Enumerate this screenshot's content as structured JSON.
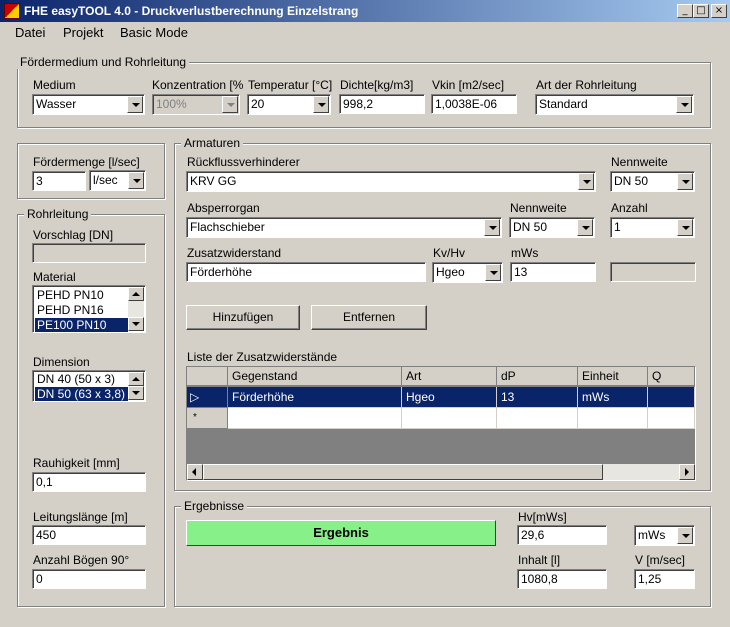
{
  "window": {
    "title": "FHE easyTOOL 4.0 - Druckverlustberechnung Einzelstrang",
    "buttons": {
      "minimize": "_",
      "maximize": "□",
      "close": "×"
    }
  },
  "menu": [
    "Datei",
    "Projekt",
    "Basic Mode"
  ],
  "medium_group": {
    "title": "Fördermedium und Rohrleitung",
    "medium_label": "Medium",
    "medium_value": "Wasser",
    "konz_label": "Konzentration [%",
    "konz_value": "100%",
    "temp_label": "Temperatur [°C]",
    "temp_value": "20",
    "dichte_label": "Dichte[kg/m3]",
    "dichte_value": "998,2",
    "vkin_label": "Vkin [m2/sec]",
    "vkin_value": "1,0038E-06",
    "art_label": "Art der Rohrleitung",
    "art_value": "Standard"
  },
  "foerdermenge": {
    "label": "Fördermenge [l/sec]",
    "value": "3",
    "unit": "l/sec"
  },
  "rohrleitung": {
    "title": "Rohrleitung",
    "vorschlag_label": "Vorschlag [DN]",
    "vorschlag_value": "",
    "material_label": "Material",
    "material_items": [
      "PEHD PN10",
      "PEHD PN16",
      "PE100 PN10"
    ],
    "material_selected": 2,
    "dimension_label": "Dimension",
    "dimension_items": [
      "DN 40 (50 x 3)",
      "DN 50 (63 x 3,8)"
    ],
    "dimension_selected": 1,
    "rauhigkeit_label": "Rauhigkeit [mm]",
    "rauhigkeit_value": "0,1",
    "laenge_label": "Leitungslänge [m]",
    "laenge_value": "450",
    "boegen_label": "Anzahl Bögen 90°",
    "boegen_value": "0"
  },
  "armaturen": {
    "title": "Armaturen",
    "rv_label": "Rückflussverhinderer",
    "rv_value": "KRV GG",
    "nw1_label": "Nennweite",
    "nw1_value": "DN 50",
    "abs_label": "Absperrorgan",
    "abs_value": "Flachschieber",
    "nw2_label": "Nennweite",
    "nw2_value": "DN 50",
    "anzahl_label": "Anzahl",
    "anzahl_value": "1",
    "zus_label": "Zusatzwiderstand",
    "zus_value": "Förderhöhe",
    "kvhv_label": "Kv/Hv",
    "kvhv_value": "Hgeo",
    "mws_label": "mWs",
    "mws_value": "13",
    "extra_value": "",
    "add_button": "Hinzufügen",
    "remove_button": "Entfernen",
    "list_label": "Liste der Zusatzwiderstände",
    "columns": [
      "Gegenstand",
      "Art",
      "dP",
      "Einheit",
      "Q"
    ],
    "rows": [
      {
        "marker": "▷",
        "cells": [
          "Förderhöhe",
          "Hgeo",
          "13",
          "mWs",
          ""
        ]
      },
      {
        "marker": "*",
        "cells": [
          "",
          "",
          "",
          "",
          ""
        ]
      }
    ]
  },
  "ergebnisse": {
    "title": "Ergebnisse",
    "button": "Ergebnis",
    "hv_label": "Hv[mWs]",
    "hv_value": "29,6",
    "hv_unit": "mWs",
    "inhalt_label": "Inhalt [l]",
    "inhalt_value": "1080,8",
    "v_label": "V [m/sec]",
    "v_value": "1,25"
  },
  "colors": {
    "titlebar_start": "#0a246a",
    "titlebar_end": "#a6caf0",
    "selection": "#0a246a",
    "result_button": "#88f088",
    "face": "#d4d0c8"
  }
}
